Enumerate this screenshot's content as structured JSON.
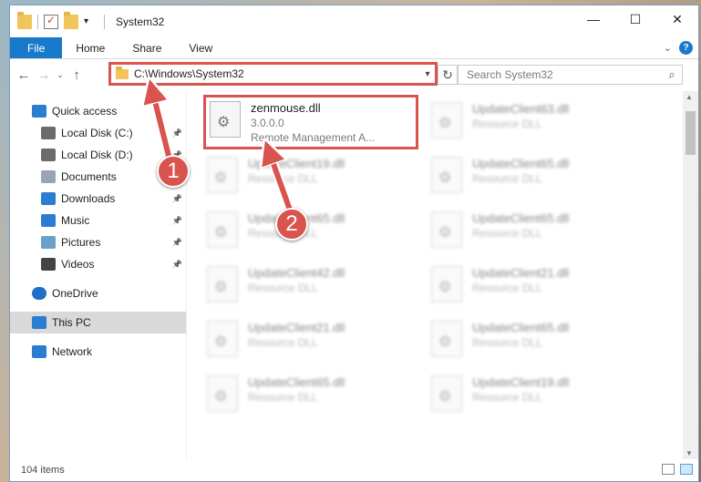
{
  "window": {
    "title": "System32",
    "controls": {
      "minimize": "—",
      "maximize": "☐",
      "close": "✕"
    }
  },
  "ribbon": {
    "tabs": [
      "File",
      "Home",
      "Share",
      "View"
    ]
  },
  "navbar": {
    "address": "C:\\Windows\\System32",
    "search_placeholder": "Search System32"
  },
  "sidebar": {
    "items": [
      {
        "label": "Quick access",
        "icon": "star-icon",
        "pinned": false
      },
      {
        "label": "Local Disk (C:)",
        "icon": "drive-icon",
        "pinned": true
      },
      {
        "label": "Local Disk (D:)",
        "icon": "drive-icon",
        "pinned": true
      },
      {
        "label": "Documents",
        "icon": "documents-icon",
        "pinned": true
      },
      {
        "label": "Downloads",
        "icon": "downloads-icon",
        "pinned": true
      },
      {
        "label": "Music",
        "icon": "music-icon",
        "pinned": true
      },
      {
        "label": "Pictures",
        "icon": "pictures-icon",
        "pinned": true
      },
      {
        "label": "Videos",
        "icon": "videos-icon",
        "pinned": true
      },
      {
        "label": "OneDrive",
        "icon": "cloud-icon",
        "pinned": false
      },
      {
        "label": "This PC",
        "icon": "monitor-icon",
        "pinned": false,
        "selected": true
      },
      {
        "label": "Network",
        "icon": "network-icon",
        "pinned": false
      }
    ]
  },
  "files": [
    {
      "name": "zenmouse.dll",
      "version": "3.0.0.0",
      "desc": "Remote Management A..."
    },
    {
      "name": "UpdateClient63.dll",
      "desc": "Resource DLL"
    },
    {
      "name": "UpdateClient19.dll",
      "desc": "Resource DLL"
    },
    {
      "name": "UpdateClient65.dll",
      "desc": "Resource DLL"
    },
    {
      "name": "UpdateClient65.dll",
      "desc": "Resource DLL"
    },
    {
      "name": "UpdateClient65.dll",
      "desc": "Resource DLL"
    },
    {
      "name": "UpdateClient42.dll",
      "desc": "Resource DLL"
    },
    {
      "name": "UpdateClient21.dll",
      "desc": "Resource DLL"
    },
    {
      "name": "UpdateClient21.dll",
      "desc": "Resource DLL"
    },
    {
      "name": "UpdateClient65.dll",
      "desc": "Resource DLL"
    },
    {
      "name": "UpdateClient65.dll",
      "desc": "Resource DLL"
    },
    {
      "name": "UpdateClient19.dll",
      "desc": "Resource DLL"
    }
  ],
  "status": {
    "items": "104 items"
  },
  "annotations": {
    "step1": "1",
    "step2": "2",
    "color": "#d9534f"
  }
}
